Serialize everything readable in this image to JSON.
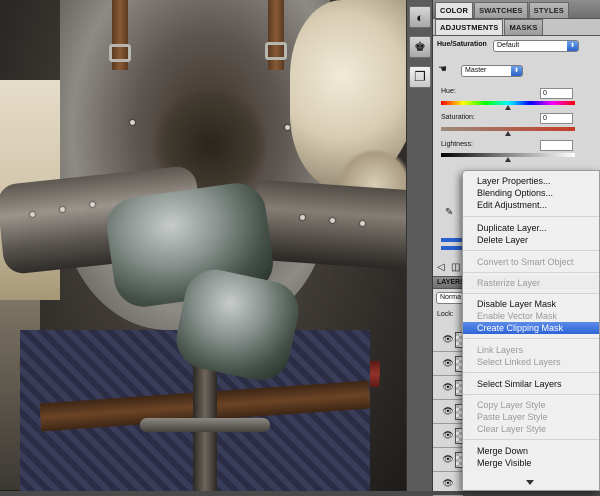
{
  "panel": {
    "tabs_top": [
      "COLOR",
      "SWATCHES",
      "STYLES"
    ],
    "tabs_adjust": [
      "ADJUSTMENTS",
      "MASKS"
    ],
    "adjustment_title": "Hue/Saturation",
    "preset_value": "Default",
    "channel_value": "Master",
    "hue_label": "Hue:",
    "hue_value": "0",
    "saturation_label": "Saturation:",
    "saturation_value": "0",
    "lightness_label": "Lightness:",
    "lightness_value": "",
    "layers_tab": "LAYERS",
    "blend_mode": "Norma",
    "lock_label": "Lock:"
  },
  "context_menu": {
    "items": [
      {
        "label": "Layer Properties...",
        "disabled": false
      },
      {
        "label": "Blending Options...",
        "disabled": false
      },
      {
        "label": "Edit Adjustment...",
        "disabled": false
      },
      {
        "label": "Duplicate Layer...",
        "disabled": false
      },
      {
        "label": "Delete Layer",
        "disabled": false
      },
      {
        "label": "Convert to Smart Object",
        "disabled": true
      },
      {
        "label": "Rasterize Layer",
        "disabled": true
      },
      {
        "label": "Disable Layer Mask",
        "disabled": false
      },
      {
        "label": "Enable Vector Mask",
        "disabled": true
      },
      {
        "label": "Create Clipping Mask",
        "disabled": false,
        "highlighted": true
      },
      {
        "label": "Link Layers",
        "disabled": true
      },
      {
        "label": "Select Linked Layers",
        "disabled": true
      },
      {
        "label": "Select Similar Layers",
        "disabled": false
      },
      {
        "label": "Copy Layer Style",
        "disabled": true
      },
      {
        "label": "Paste Layer Style",
        "disabled": true
      },
      {
        "label": "Clear Layer Style",
        "disabled": true
      },
      {
        "label": "Merge Down",
        "disabled": false
      },
      {
        "label": "Merge Visible",
        "disabled": false
      }
    ]
  },
  "icons": {
    "tool_1": "adjustments-icon",
    "tool_2": "channels-icon",
    "tool_3": "layers-panel-icon",
    "hand": "targeted-adjustment-icon",
    "eyedropper": "eyedropper-icon",
    "more": "chevron-down-icon"
  },
  "colors": {
    "menu_highlight": "#2e64d8",
    "panel_bg": "#d7d7d7"
  }
}
